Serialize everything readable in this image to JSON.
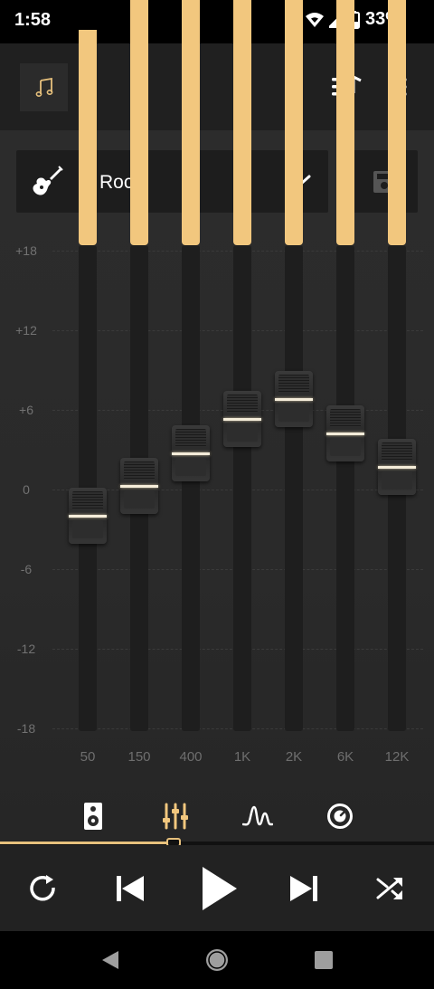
{
  "status": {
    "time": "1:58",
    "battery": "33%"
  },
  "appbar": {
    "icons": [
      "music-note-icon",
      "queue-music-icon",
      "more-vert-icon"
    ]
  },
  "preset": {
    "name": "Rock",
    "icon": "guitar-icon"
  },
  "colors": {
    "accent": "#f2c77e",
    "background": "#2a2a2a",
    "track": "#1e1e1e"
  },
  "equalizer": {
    "db_labels": [
      "+18",
      "+12",
      "+6",
      "0",
      "-6",
      "-12",
      "-18"
    ],
    "range_db": [
      -18,
      18
    ],
    "bands": [
      {
        "freq": "50",
        "gain_db": -2
      },
      {
        "freq": "150",
        "gain_db": 0.3
      },
      {
        "freq": "400",
        "gain_db": 2.7
      },
      {
        "freq": "1K",
        "gain_db": 5.3
      },
      {
        "freq": "2K",
        "gain_db": 6.8
      },
      {
        "freq": "6K",
        "gain_db": 4.2
      },
      {
        "freq": "12K",
        "gain_db": 1.7
      }
    ]
  },
  "tabs": [
    {
      "icon": "speaker-icon",
      "active": false
    },
    {
      "icon": "equalizer-sliders-icon",
      "active": true
    },
    {
      "icon": "waveform-icon",
      "active": false
    },
    {
      "icon": "volume-dial-icon",
      "active": false
    }
  ],
  "playback": {
    "progress": 0.4,
    "controls": [
      "repeat-icon",
      "skip-previous-icon",
      "play-icon",
      "skip-next-icon",
      "shuffle-icon"
    ]
  },
  "navbar": {
    "icons": [
      "back-icon",
      "home-icon",
      "recents-icon"
    ]
  }
}
